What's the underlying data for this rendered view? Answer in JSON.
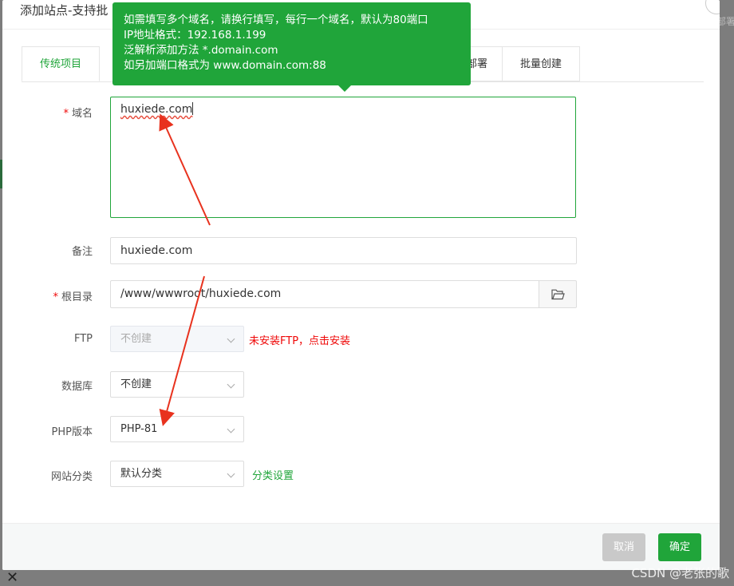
{
  "background": {
    "right_text": "部署"
  },
  "dialog": {
    "title": "添加站点-支持批",
    "tabs_left": [
      "传统项目"
    ],
    "tabs_right": [
      "部署",
      "批量创建"
    ],
    "tooltip": [
      "如需填写多个域名，请换行填写，每行一个域名，默认为80端口",
      "IP地址格式：192.168.1.199",
      "泛解析添加方法 *.domain.com",
      "如另加端口格式为 www.domain.com:88"
    ],
    "form": {
      "domain": {
        "label": "域名",
        "value": "huxiede.com"
      },
      "remark": {
        "label": "备注",
        "value": "huxiede.com"
      },
      "root": {
        "label": "根目录",
        "value": "/www/wwwroot/huxiede.com"
      },
      "ftp": {
        "label": "FTP",
        "value": "不创建",
        "note": "未安装FTP，点击安装"
      },
      "database": {
        "label": "数据库",
        "value": "不创建"
      },
      "php": {
        "label": "PHP版本",
        "value": "PHP-81"
      },
      "category": {
        "label": "网站分类",
        "value": "默认分类",
        "link": "分类设置"
      }
    },
    "buttons": {
      "cancel": "取消",
      "ok": "确定"
    }
  },
  "watermark": "CSDN @老张的歌",
  "colors": {
    "accent": "#20a53a",
    "danger": "#ef0808",
    "arrow": "#e8321e"
  },
  "icons": {
    "folder": "folder-icon",
    "close": "close-icon"
  }
}
